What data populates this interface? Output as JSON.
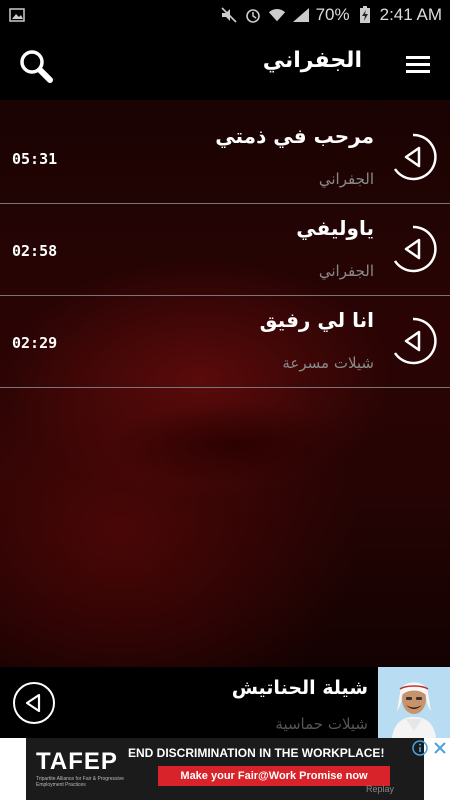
{
  "status_bar": {
    "battery": "70%",
    "time": "2:41 AM",
    "icons": [
      "image-notification-icon",
      "mute-icon",
      "alarm-icon",
      "wifi-icon",
      "signal-icon",
      "battery-charging-icon"
    ]
  },
  "app_bar": {
    "title": "الجفراني",
    "search_icon": "search-icon",
    "menu_icon": "hamburger-menu-icon"
  },
  "tracks": [
    {
      "title": "مرحب في ذمتي",
      "artist": "الجفراني",
      "duration": "05:31"
    },
    {
      "title": "ياوليفي",
      "artist": "الجفراني",
      "duration": "02:58"
    },
    {
      "title": "انا لي رفيق",
      "artist": "شيلات مسرعة",
      "duration": "02:29"
    }
  ],
  "now_playing": {
    "title": "شيلة الحناتيش",
    "artist": "شيلات حماسية"
  },
  "ad": {
    "logo": "TAFEP",
    "logo_sub": "Tripartite Alliance for Fair & Progressive Employment Practices",
    "headline": "END DISCRIMINATION IN THE WORKPLACE!",
    "cta": "Make your Fair@Work Promise now",
    "replay": "Replay"
  },
  "colors": {
    "accent_red": "#d8232a",
    "background_dark_red": "#2a0404",
    "divider": "#777777"
  }
}
